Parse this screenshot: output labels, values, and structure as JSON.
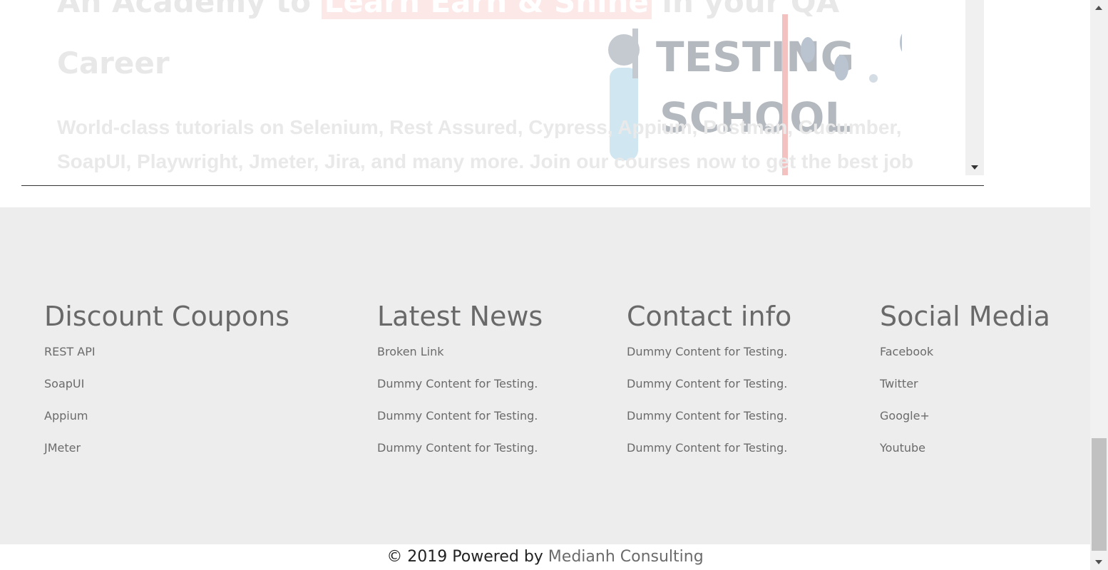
{
  "hero": {
    "title_pre": "An Academy to ",
    "title_highlight": "Learn Earn & Shine",
    "title_post": "  in your QA Career",
    "text": "World-class tutorials on Selenium, Rest Assured, Cypress, Appium, Postman, Cucumber, SoapUI, Playwright, Jmeter, Jira, and many more. Join our courses now to get the best job",
    "art_text_1": "TESTING",
    "art_text_2": "SCHOOL"
  },
  "footer": {
    "columns": [
      {
        "heading": "Discount Coupons",
        "items": [
          "REST API",
          "SoapUI",
          "Appium",
          "JMeter"
        ]
      },
      {
        "heading": "Latest News",
        "items": [
          "Broken Link",
          "Dummy Content for Testing.",
          "Dummy Content for Testing.",
          "Dummy Content for Testing."
        ]
      },
      {
        "heading": "Contact info",
        "items": [
          "Dummy Content for Testing.",
          "Dummy Content for Testing.",
          "Dummy Content for Testing.",
          "Dummy Content for Testing."
        ]
      },
      {
        "heading": "Social Media",
        "items": [
          "Facebook",
          "Twitter",
          "Google+",
          "Youtube"
        ]
      }
    ]
  },
  "copyright": {
    "prefix": "© 2019 Powered by ",
    "company": "Medianh Consulting"
  },
  "colors": {
    "footer_bg": "#ededed",
    "footer_text": "#6b6b6b",
    "hero_highlight_bg": "#fde8e8"
  }
}
